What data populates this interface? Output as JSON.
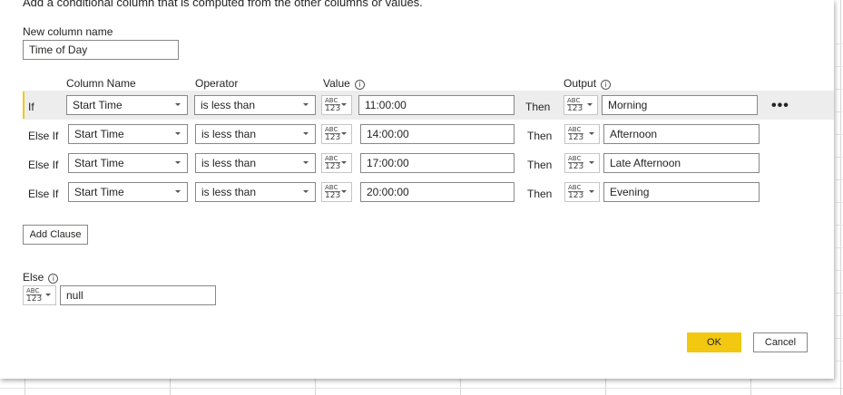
{
  "dialog": {
    "subtitle": "Add a conditional column that is computed from the other columns or values.",
    "new_column_label": "New column name",
    "new_column_value": "Time of Day"
  },
  "headers": {
    "column_name": "Column Name",
    "operator": "Operator",
    "value": "Value",
    "output": "Output"
  },
  "type_icon": {
    "abc": "ABC",
    "num": "123"
  },
  "clauses": [
    {
      "label": "If",
      "column": "Start Time",
      "operator": "is less than",
      "value": "11:00:00",
      "then": "Then",
      "output": "Morning",
      "selected": true
    },
    {
      "label": "Else If",
      "column": "Start Time",
      "operator": "is less than",
      "value": "14:00:00",
      "then": "Then",
      "output": "Afternoon",
      "selected": false
    },
    {
      "label": "Else If",
      "column": "Start Time",
      "operator": "is less than",
      "value": "17:00:00",
      "then": "Then",
      "output": "Late Afternoon",
      "selected": false
    },
    {
      "label": "Else If",
      "column": "Start Time",
      "operator": "is less than",
      "value": "20:00:00",
      "then": "Then",
      "output": "Evening",
      "selected": false
    }
  ],
  "more_options": "•••",
  "add_clause_label": "Add Clause",
  "else": {
    "label": "Else",
    "value": "null"
  },
  "buttons": {
    "ok": "OK",
    "cancel": "Cancel"
  },
  "colors": {
    "accent": "#f2c811",
    "selected_row": "#ededed",
    "border": "#8a8886"
  },
  "icons": [
    "info-icon",
    "type-abc123-icon",
    "chevron-down-icon",
    "more-options-icon"
  ]
}
